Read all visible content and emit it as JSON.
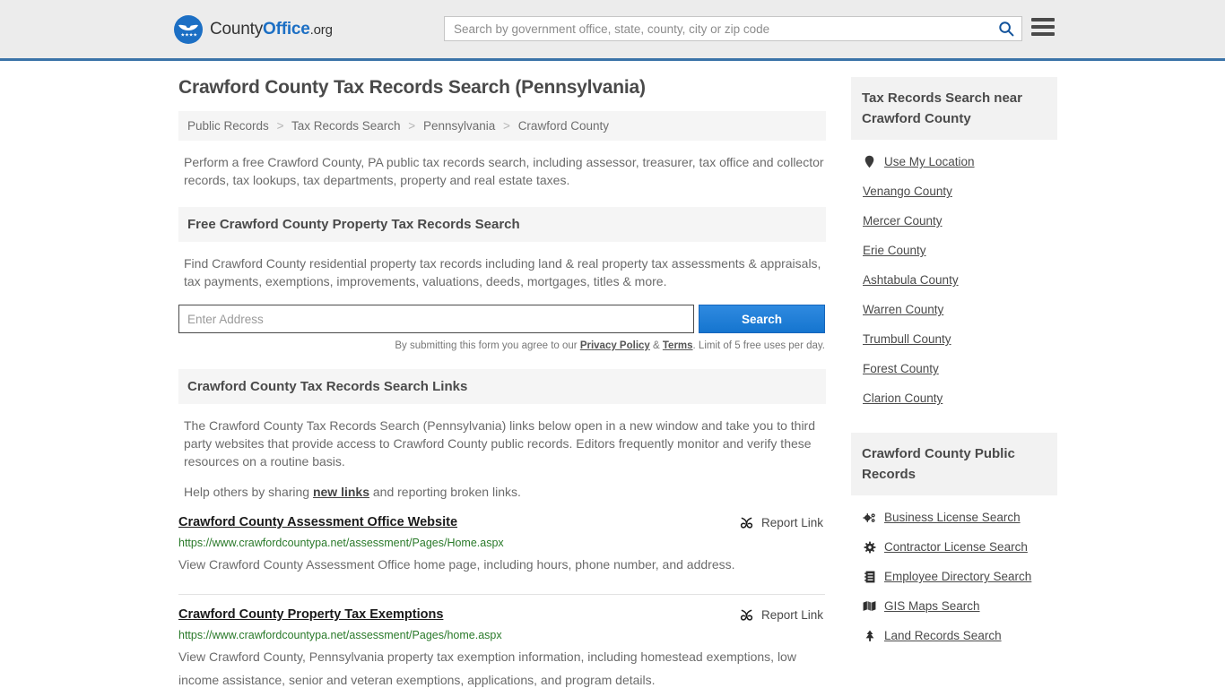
{
  "header": {
    "logo": {
      "part1": "County",
      "part2": "Office",
      "part3": ".org",
      "icon": "eagle-badge-icon"
    },
    "search": {
      "placeholder": "Search by government office, state, county, city or zip code",
      "value": "",
      "icon": "search-icon"
    },
    "menu_icon": "hamburger-menu-icon"
  },
  "main": {
    "title": "Crawford County Tax Records Search (Pennsylvania)",
    "breadcrumb": [
      {
        "label": "Public Records"
      },
      {
        "label": "Tax Records Search"
      },
      {
        "label": "Pennsylvania"
      },
      {
        "label": "Crawford County"
      }
    ],
    "breadcrumb_separator": ">",
    "intro": "Perform a free Crawford County, PA public tax records search, including assessor, treasurer, tax office and collector records, tax lookups, tax departments, property and real estate taxes.",
    "property_search": {
      "heading": "Free Crawford County Property Tax Records Search",
      "description": "Find Crawford County residential property tax records including land & real property tax assessments & appraisals, tax payments, exemptions, improvements, valuations, deeds, mortgages, titles & more.",
      "input_placeholder": "Enter Address",
      "input_value": "",
      "submit_label": "Search",
      "fineprint_pre": "By submitting this form you agree to our ",
      "fineprint_privacy": "Privacy Policy",
      "fineprint_amp": " & ",
      "fineprint_terms": "Terms",
      "fineprint_post": ". Limit of 5 free uses per day."
    },
    "links_section": {
      "heading": "Crawford County Tax Records Search Links",
      "paragraph": "The Crawford County Tax Records Search (Pennsylvania) links below open in a new window and take you to third party websites that provide access to Crawford County public records. Editors frequently monitor and verify these resources on a routine basis.",
      "help_pre": "Help others by sharing ",
      "help_link": "new links",
      "help_post": " and reporting broken links."
    },
    "report_link_label": "Report Link",
    "report_link_icon": "broken-link-icon",
    "results": [
      {
        "title": "Crawford County Assessment Office Website",
        "url": "https://www.crawfordcountypa.net/assessment/Pages/Home.aspx",
        "description": "View Crawford County Assessment Office home page, including hours, phone number, and address."
      },
      {
        "title": "Crawford County Property Tax Exemptions",
        "url": "https://www.crawfordcountypa.net/assessment/Pages/home.aspx",
        "description": "View Crawford County, Pennsylvania property tax exemption information, including homestead exemptions, low income assistance, senior and veteran exemptions, applications, and program details."
      }
    ]
  },
  "sidebar": {
    "nearby": {
      "heading": "Tax Records Search near Crawford County",
      "items": [
        {
          "label": "Use My Location",
          "icon": "map-pin-icon"
        },
        {
          "label": "Venango County",
          "icon": ""
        },
        {
          "label": "Mercer County",
          "icon": ""
        },
        {
          "label": "Erie County",
          "icon": ""
        },
        {
          "label": "Ashtabula County",
          "icon": ""
        },
        {
          "label": "Warren County",
          "icon": ""
        },
        {
          "label": "Trumbull County",
          "icon": ""
        },
        {
          "label": "Forest County",
          "icon": ""
        },
        {
          "label": "Clarion County",
          "icon": ""
        }
      ]
    },
    "public_records": {
      "heading": "Crawford County Public Records",
      "items": [
        {
          "label": "Business License Search",
          "icon": "gears-icon"
        },
        {
          "label": "Contractor License Search",
          "icon": "gear-icon"
        },
        {
          "label": "Employee Directory Search",
          "icon": "directory-icon"
        },
        {
          "label": "GIS Maps Search",
          "icon": "map-icon"
        },
        {
          "label": "Land Records Search",
          "icon": "tree-icon"
        }
      ]
    }
  },
  "colors": {
    "brand_blue": "#1c6fc4",
    "header_border": "#3b73a8",
    "button_blue": "#1575cf",
    "url_green": "#2a7a2a",
    "panel_gray": "#f5f5f5"
  }
}
